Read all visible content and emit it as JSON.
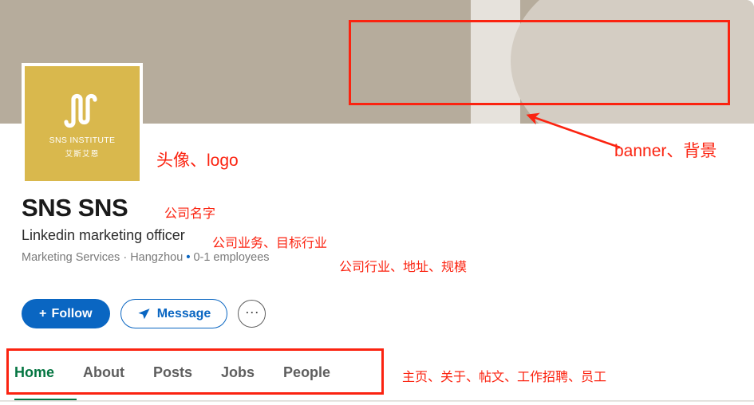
{
  "banner": {
    "colors": {
      "left": "#b6ac9c",
      "cream_band": "#e6e2dc",
      "curve": "#d4cdc3"
    }
  },
  "avatar": {
    "background_color": "#d9b84d",
    "mark": "sns-wave-mark",
    "wordmark": "SNS INSTITUTE",
    "subtext": "艾斯艾恩"
  },
  "profile": {
    "company_name": "SNS SNS",
    "tagline": "Linkedin marketing officer",
    "meta": {
      "industry": "Marketing Services",
      "separator": " · ",
      "location": "Hangzhou",
      "bullet": " • ",
      "size": "0-1 employees"
    }
  },
  "actions": {
    "follow_label": "Follow",
    "follow_plus": "+",
    "message_label": "Message",
    "more_label": "···",
    "accent_color": "#0a66c2"
  },
  "nav": {
    "active_color": "#057642",
    "tabs": [
      {
        "label": "Home",
        "active": true
      },
      {
        "label": "About",
        "active": false
      },
      {
        "label": "Posts",
        "active": false
      },
      {
        "label": "Jobs",
        "active": false
      },
      {
        "label": "People",
        "active": false
      }
    ]
  },
  "annotations": {
    "color": "#fb2310",
    "banner_label": "banner、背景",
    "logo_label": "头像、logo",
    "company_name_label": "公司名字",
    "business_label": "公司业务、目标行业",
    "meta_label": "公司行业、地址、规模",
    "tabs_label": "主页、关于、帖文、工作招聘、员工"
  }
}
